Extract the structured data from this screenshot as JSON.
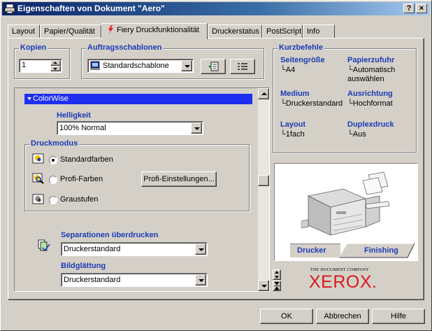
{
  "window": {
    "title": "Eigenschaften von Dokument \"Aero\"",
    "help_btn": "?",
    "close_btn": "×"
  },
  "tabs": [
    {
      "label": "Layout"
    },
    {
      "label": "Papier/Qualität"
    },
    {
      "label": "Fiery Druckfunktionalität",
      "active": true
    },
    {
      "label": "Druckerstatus"
    },
    {
      "label": "PostScript"
    },
    {
      "label": "Info"
    }
  ],
  "copies": {
    "label": "Kopien",
    "value": "1"
  },
  "templates": {
    "label": "Auftragsschablonen",
    "selected": "Standardschablone"
  },
  "colorwise": {
    "header": "ColorWise",
    "brightness": {
      "label": "Helligkeit",
      "selected": "100% Normal"
    },
    "printmode": {
      "label": "Druckmodus",
      "options": [
        {
          "label": "Standardfarben",
          "checked": true
        },
        {
          "label": "Profi-Farben",
          "checked": false
        },
        {
          "label": "Graustufen",
          "checked": false
        }
      ],
      "pro_settings_button": "Profi-Einstellungen..."
    },
    "overprint": {
      "label": "Separationen überdrucken",
      "selected": "Druckerstandard"
    },
    "smoothing": {
      "label": "Bildglättung",
      "selected": "Druckerstandard"
    }
  },
  "shortcuts": {
    "label": "Kurzbefehle",
    "items": [
      {
        "title": "Seitengröße",
        "value": "A4"
      },
      {
        "title": "Papierzufuhr",
        "value": "Automatisch auswählen"
      },
      {
        "title": "Medium",
        "value": "Druckerstandard"
      },
      {
        "title": "Ausrichtung",
        "value": "Hochformat"
      },
      {
        "title": "Layout",
        "value": "1fach"
      },
      {
        "title": "Duplexdruck",
        "value": "Aus"
      }
    ]
  },
  "printer_panel": {
    "tab_printer": "Drucker",
    "tab_finishing": "Finishing"
  },
  "brand": {
    "tagline": "THE DOCUMENT COMPANY",
    "name": "XEROX.",
    "color": "#d71920"
  },
  "buttons": {
    "ok": "OK",
    "cancel": "Abbrechen",
    "help": "Hilfe"
  },
  "colors": {
    "accent": "#1c3bb5",
    "title_bar": "#0a246a",
    "dialog_bg": "#d4d0c8"
  }
}
